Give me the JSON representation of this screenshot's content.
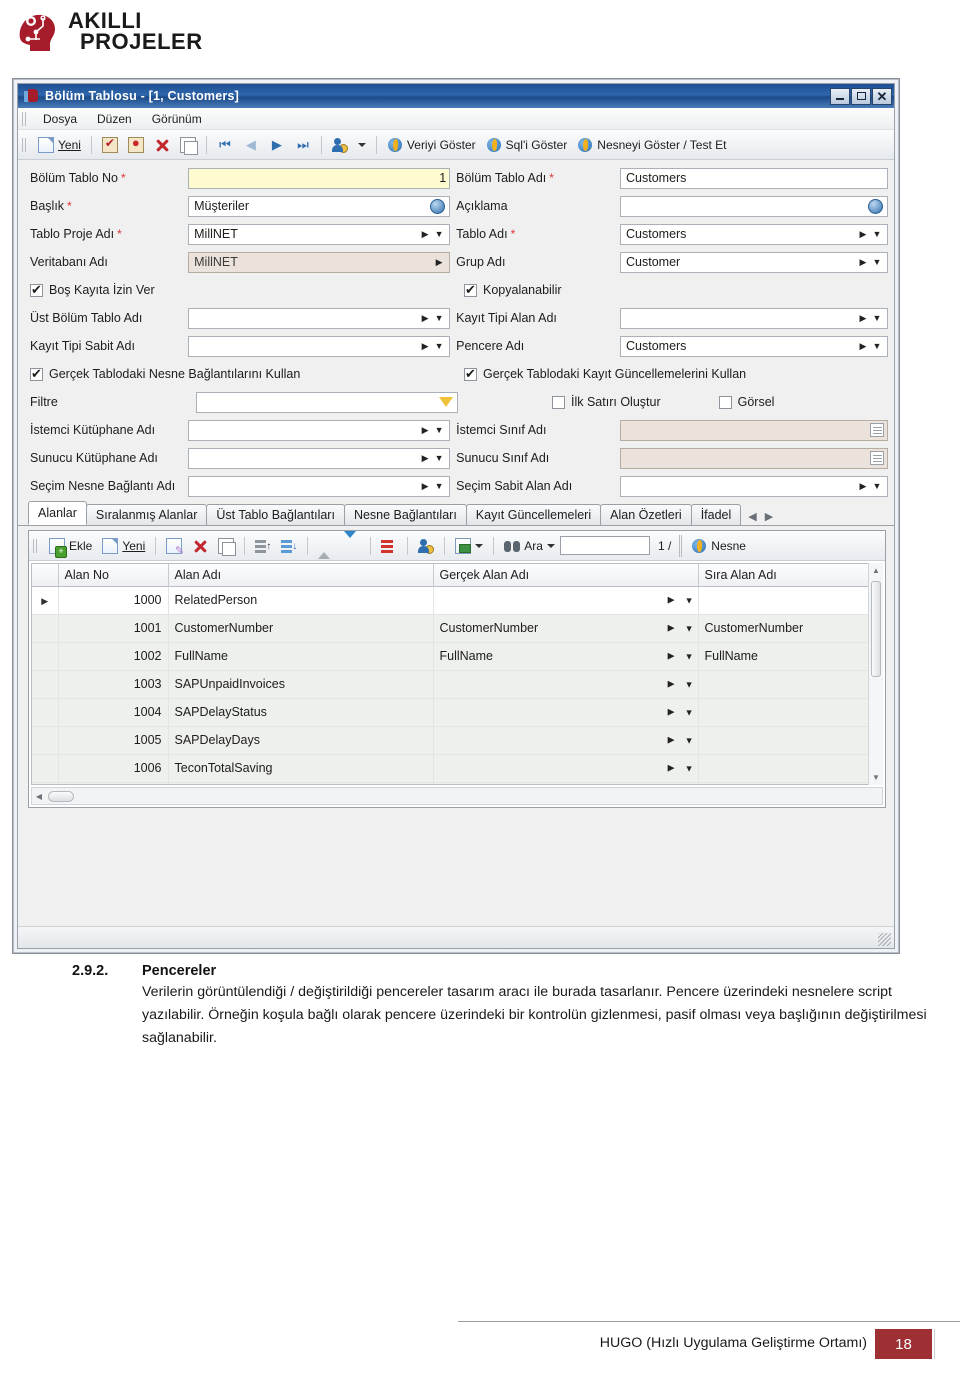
{
  "brand": {
    "line1": "AKILLI",
    "line2": "PROJELER",
    "color": "#a61c2b"
  },
  "window": {
    "title": "Bölüm Tablosu - [1, Customers]",
    "icon": "app-window-icon",
    "controls": {
      "minimize": "minimize-button",
      "maximize": "maximize-button",
      "close": "close-button"
    }
  },
  "menubar": {
    "items": [
      "Dosya",
      "Düzen",
      "Görünüm"
    ]
  },
  "toolbar": {
    "new_label": "Yeni",
    "icons": [
      "new-document-icon",
      "save-record-icon",
      "cancel-record-icon",
      "delete-icon",
      "copy-icon",
      "first-record-icon",
      "previous-record-icon",
      "next-record-icon",
      "last-record-icon",
      "record-history-icon",
      "overflow-chevron-icon"
    ],
    "actions": [
      {
        "label": "Veriyi Göster",
        "icon": "flame-icon"
      },
      {
        "label": "Sql'i Göster",
        "icon": "flame-icon"
      },
      {
        "label": "Nesneyi Göster / Test Et",
        "icon": "flame-icon"
      }
    ]
  },
  "form": {
    "rows_left": [
      {
        "label": "Bölüm Tablo No",
        "required": true,
        "value": "1",
        "type": "text-right",
        "highlight": true
      },
      {
        "label": "Başlık",
        "required": true,
        "value": "Müşteriler",
        "type": "text-globe"
      },
      {
        "label": "Tablo Proje Adı",
        "required": true,
        "value": "MillNET",
        "type": "lookup"
      },
      {
        "label": "Veritabanı Adı",
        "required": false,
        "value": "MillNET",
        "type": "lookup-readonly"
      },
      {
        "label": "Boş Kayıta İzin Ver",
        "type": "checkbox",
        "checked": true
      },
      {
        "label": "Üst Bölüm Tablo Adı",
        "required": false,
        "value": "",
        "type": "lookup"
      },
      {
        "label": "Kayıt Tipi Sabit Adı",
        "required": false,
        "value": "",
        "type": "lookup"
      },
      {
        "label": "Gerçek Tablodaki Nesne Bağlantılarını Kullan",
        "type": "checkbox",
        "checked": true
      },
      {
        "label": "Filtre",
        "required": false,
        "value": "",
        "type": "filter"
      },
      {
        "label": "İstemci Kütüphane Adı",
        "required": false,
        "value": "",
        "type": "lookup"
      },
      {
        "label": "Sunucu Kütüphane Adı",
        "required": false,
        "value": "",
        "type": "lookup"
      },
      {
        "label": "Seçim Nesne Bağlantı Adı",
        "required": false,
        "value": "",
        "type": "lookup"
      }
    ],
    "rows_right": [
      {
        "label": "Bölüm Tablo Adı",
        "required": true,
        "value": "Customers",
        "type": "text"
      },
      {
        "label": "Açıklama",
        "required": false,
        "value": "",
        "type": "text-globe"
      },
      {
        "label": "Tablo Adı",
        "required": true,
        "value": "Customers",
        "type": "lookup"
      },
      {
        "label": "Grup Adı",
        "required": false,
        "value": "Customer",
        "type": "lookup"
      },
      {
        "label": "Kopyalanabilir",
        "type": "checkbox",
        "checked": true
      },
      {
        "label": "Kayıt Tipi Alan Adı",
        "required": false,
        "value": "",
        "type": "lookup"
      },
      {
        "label": "Pencere Adı",
        "required": false,
        "value": "Customers",
        "type": "lookup"
      },
      {
        "label": "Gerçek Tablodaki Kayıt Güncellemelerini Kullan",
        "type": "checkbox",
        "checked": true
      },
      {
        "label": "İlk Satırı Oluştur",
        "type": "checkbox",
        "checked": false,
        "label2": "Görsel",
        "checked2": false
      },
      {
        "label": "İstemci Sınıf Adı",
        "required": false,
        "value": "",
        "type": "memo-readonly"
      },
      {
        "label": "Sunucu Sınıf Adı",
        "required": false,
        "value": "",
        "type": "memo-readonly"
      },
      {
        "label": "Seçim Sabit Alan Adı",
        "required": false,
        "value": "",
        "type": "lookup"
      }
    ]
  },
  "tabs": {
    "items": [
      "Alanlar",
      "Sıralanmış Alanlar",
      "Üst Tablo Bağlantıları",
      "Nesne Bağlantıları",
      "Kayıt Güncellemeleri",
      "Alan Özetleri",
      "İfadel"
    ],
    "active_index": 0,
    "nav_prev_icon": "tab-scroll-left-icon",
    "nav_next_icon": "tab-scroll-right-icon"
  },
  "grid_toolbar": {
    "add_label": "Ekle",
    "new_label": "Yeni",
    "search_label": "Ara",
    "search_value": "",
    "page_counter": "1 /",
    "object_button_label": "Nesne",
    "icons": [
      "add-row-icon",
      "new-row-icon",
      "edit-row-icon",
      "delete-row-icon",
      "copy-row-icon",
      "move-up-icon",
      "move-down-icon",
      "collapse-all-icon",
      "expand-all-icon",
      "clear-rows-icon",
      "row-history-icon",
      "save-rows-icon",
      "binoculars-icon"
    ]
  },
  "grid": {
    "columns": [
      "Alan No",
      "Alan Adı",
      "Gerçek Alan Adı",
      "Sıra Alan Adı"
    ],
    "rows": [
      {
        "no": "1000",
        "alan_adi": "RelatedPerson",
        "gercek_alan_adi": "",
        "sira_alan_adi": "",
        "current": true
      },
      {
        "no": "1001",
        "alan_adi": "CustomerNumber",
        "gercek_alan_adi": "CustomerNumber",
        "sira_alan_adi": "CustomerNumber",
        "current": false
      },
      {
        "no": "1002",
        "alan_adi": "FullName",
        "gercek_alan_adi": "FullName",
        "sira_alan_adi": "FullName",
        "current": false
      },
      {
        "no": "1003",
        "alan_adi": "SAPUnpaidInvoices",
        "gercek_alan_adi": "",
        "sira_alan_adi": "",
        "current": false
      },
      {
        "no": "1004",
        "alan_adi": "SAPDelayStatus",
        "gercek_alan_adi": "",
        "sira_alan_adi": "",
        "current": false
      },
      {
        "no": "1005",
        "alan_adi": "SAPDelayDays",
        "gercek_alan_adi": "",
        "sira_alan_adi": "",
        "current": false
      },
      {
        "no": "1006",
        "alan_adi": "TeconTotalSaving",
        "gercek_alan_adi": "",
        "sira_alan_adi": "",
        "current": false
      }
    ]
  },
  "document": {
    "section_number": "2.9.2.",
    "section_title": "Pencereler",
    "paragraph": "Verilerin görüntülendiği / değiştirildiği pencereler tasarım aracı ile burada tasarlanır. Pencere üzerindeki nesnelere script yazılabilir. Örneğin koşula bağlı olarak pencere üzerindeki bir kontrolün gizlenmesi, pasif olması veya başlığının değiştirilmesi sağlanabilir."
  },
  "footer": {
    "text": "HUGO (Hızlı Uygulama Geliştirme Ortamı)",
    "page_number": "18",
    "accent_color": "#9e3033"
  }
}
